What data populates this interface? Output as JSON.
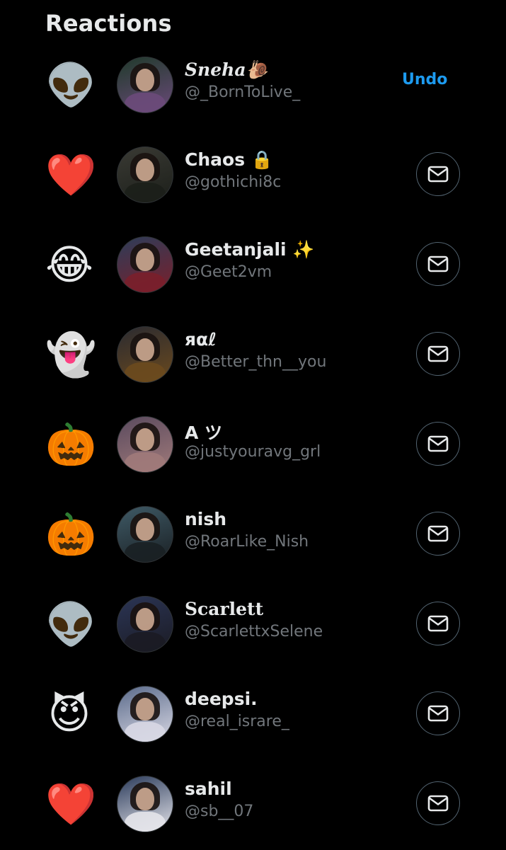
{
  "header": {
    "title": "Reactions"
  },
  "undo_label": "Undo",
  "rows": [
    {
      "reaction": "👽",
      "reaction_icon": "alien-icon",
      "name": "Sneha🐌",
      "handle": "@_BornToLive_",
      "action": "undo",
      "avatar_colors": [
        "#1f3a2a",
        "#6b4a7a"
      ]
    },
    {
      "reaction": "❤️",
      "reaction_icon": "red-heart-icon",
      "name": "Chaos 🔒",
      "handle": "@gothichi8c",
      "action": "message",
      "avatar_colors": [
        "#3a3a34",
        "#1c1f1a"
      ]
    },
    {
      "reaction": "😂",
      "reaction_icon": "tears-of-joy-icon",
      "name": "Geetanjali ✨",
      "handle": "@Geet2vm",
      "action": "message",
      "avatar_colors": [
        "#2c3d59",
        "#7a1f2b"
      ]
    },
    {
      "reaction": "👻",
      "reaction_icon": "ghost-icon",
      "name": "яαℓ",
      "handle": "@Better_thn__you",
      "action": "message",
      "avatar_colors": [
        "#2a2a30",
        "#6b4a1e"
      ]
    },
    {
      "reaction": "🎃",
      "reaction_icon": "jack-o-lantern-icon",
      "name": "A ツ",
      "handle": "@justyouravg_grl",
      "action": "message",
      "avatar_colors": [
        "#5a4a5e",
        "#a07a7a"
      ]
    },
    {
      "reaction": "🎃",
      "reaction_icon": "jack-o-lantern-icon",
      "name": "nish",
      "handle": "@RoarLike_Nish",
      "action": "message",
      "avatar_colors": [
        "#3f5a66",
        "#1a2024"
      ]
    },
    {
      "reaction": "👽",
      "reaction_icon": "alien-icon",
      "name": "Scarlett",
      "handle": "@ScarlettxSelene",
      "action": "message",
      "avatar_colors": [
        "#2b3555",
        "#1b1b24"
      ]
    },
    {
      "reaction": "😈",
      "reaction_icon": "smiling-devil-icon",
      "name": "deepsi.",
      "handle": "@real_israre_",
      "action": "message",
      "avatar_colors": [
        "#5a6a8a",
        "#d8d8e4"
      ]
    },
    {
      "reaction": "❤️",
      "reaction_icon": "red-heart-icon",
      "name": "sahil",
      "handle": "@sb__07",
      "action": "message",
      "avatar_colors": [
        "#2a3a5a",
        "#e4e4ea"
      ]
    }
  ],
  "colors": {
    "background": "#000000",
    "primary_text": "#e7e9ea",
    "secondary_text": "#71767b",
    "accent": "#1d9bf0",
    "button_border": "#536471"
  }
}
